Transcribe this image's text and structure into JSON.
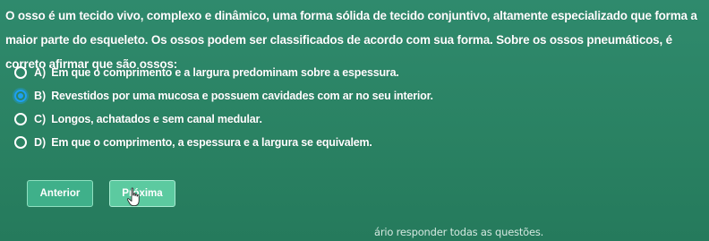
{
  "question": {
    "text": "O osso é um tecido vivo, complexo e dinâmico, uma forma sólida de tecido conjuntivo, altamente especializado que forma a maior parte do esqueleto. Os ossos podem ser classificados de acordo com sua forma. Sobre os ossos pneumáticos, é correto afirmar que são ossos:"
  },
  "options": [
    {
      "letter": "A)",
      "text": "Em que o comprimento e a largura predominam sobre a espessura.",
      "selected": false
    },
    {
      "letter": "B)",
      "text": "Revestidos por uma mucosa e possuem cavidades com ar no seu interior.",
      "selected": true
    },
    {
      "letter": "C)",
      "text": "Longos, achatados e sem canal medular.",
      "selected": false
    },
    {
      "letter": "D)",
      "text": "Em que o comprimento, a espessura e a largura se equivalem.",
      "selected": false
    }
  ],
  "nav": {
    "prev_label": "Anterior",
    "next_label": "Próxima"
  },
  "footer": {
    "text": "ário responder todas as questões."
  },
  "colors": {
    "background": "#2a8263",
    "selected_radio": "#1da0f2"
  },
  "icons": {
    "cursor": "hand-pointer-icon"
  }
}
